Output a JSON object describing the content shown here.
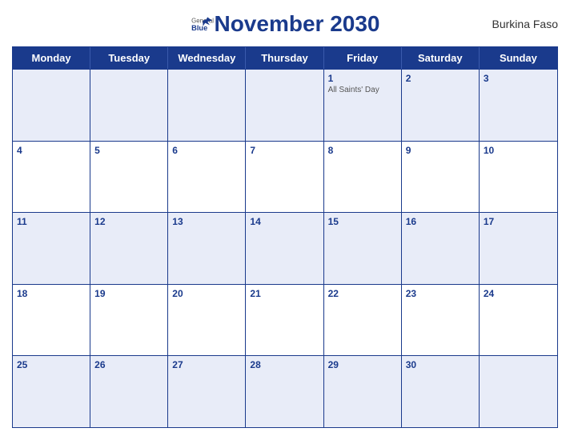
{
  "header": {
    "title": "November 2030",
    "country": "Burkina Faso",
    "logo": {
      "general": "General",
      "blue": "Blue"
    }
  },
  "days_of_week": [
    "Monday",
    "Tuesday",
    "Wednesday",
    "Thursday",
    "Friday",
    "Saturday",
    "Sunday"
  ],
  "weeks": [
    [
      {
        "date": "",
        "events": []
      },
      {
        "date": "",
        "events": []
      },
      {
        "date": "",
        "events": []
      },
      {
        "date": "",
        "events": []
      },
      {
        "date": "1",
        "events": [
          "All Saints' Day"
        ]
      },
      {
        "date": "2",
        "events": []
      },
      {
        "date": "3",
        "events": []
      }
    ],
    [
      {
        "date": "4",
        "events": []
      },
      {
        "date": "5",
        "events": []
      },
      {
        "date": "6",
        "events": []
      },
      {
        "date": "7",
        "events": []
      },
      {
        "date": "8",
        "events": []
      },
      {
        "date": "9",
        "events": []
      },
      {
        "date": "10",
        "events": []
      }
    ],
    [
      {
        "date": "11",
        "events": []
      },
      {
        "date": "12",
        "events": []
      },
      {
        "date": "13",
        "events": []
      },
      {
        "date": "14",
        "events": []
      },
      {
        "date": "15",
        "events": []
      },
      {
        "date": "16",
        "events": []
      },
      {
        "date": "17",
        "events": []
      }
    ],
    [
      {
        "date": "18",
        "events": []
      },
      {
        "date": "19",
        "events": []
      },
      {
        "date": "20",
        "events": []
      },
      {
        "date": "21",
        "events": []
      },
      {
        "date": "22",
        "events": []
      },
      {
        "date": "23",
        "events": []
      },
      {
        "date": "24",
        "events": []
      }
    ],
    [
      {
        "date": "25",
        "events": []
      },
      {
        "date": "26",
        "events": []
      },
      {
        "date": "27",
        "events": []
      },
      {
        "date": "28",
        "events": []
      },
      {
        "date": "29",
        "events": []
      },
      {
        "date": "30",
        "events": []
      },
      {
        "date": "",
        "events": []
      }
    ]
  ]
}
